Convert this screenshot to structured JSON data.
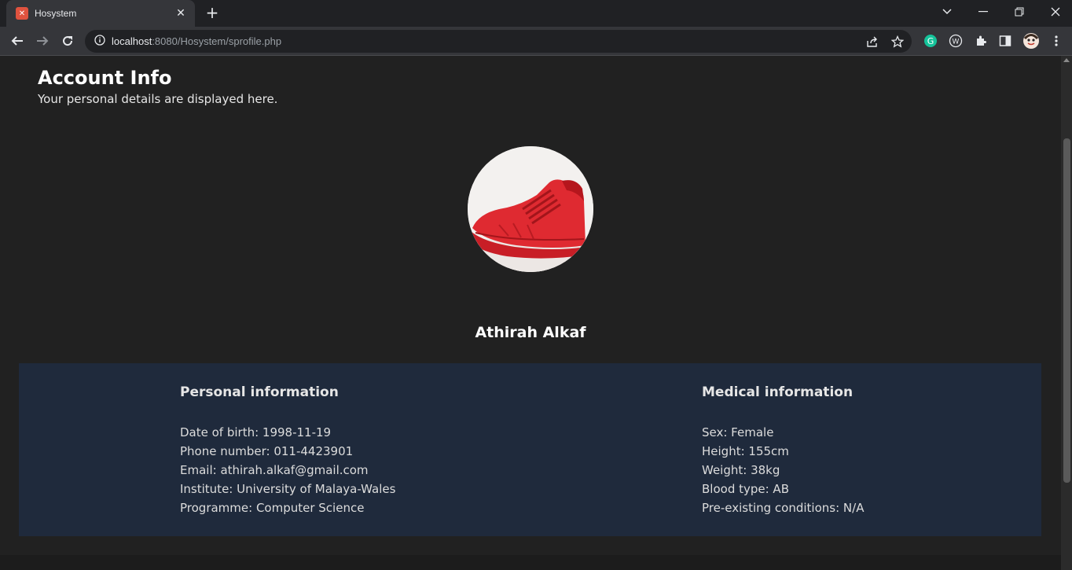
{
  "browser": {
    "tab_title": "Hosystem",
    "url_host": "localhost",
    "url_rest": ":8080/Hosystem/sprofile.php"
  },
  "page": {
    "title": "Account Info",
    "subtitle": "Your personal details are displayed here.",
    "profile_name": "Athirah Alkaf"
  },
  "personal": {
    "heading": "Personal information",
    "lines": [
      "Date of birth: 1998-11-19",
      "Phone number: 011-4423901",
      "Email: athirah.alkaf@gmail.com",
      "Institute: University of Malaya-Wales",
      "Programme: Computer Science"
    ]
  },
  "medical": {
    "heading": "Medical information",
    "lines": [
      "Sex: Female",
      "Height: 155cm",
      "Weight: 38kg",
      "Blood type: AB",
      "Pre-existing conditions: N/A"
    ]
  },
  "colors": {
    "page_bg": "#212121",
    "panel_bg": "#1f2a3c",
    "accent_shoe": "#d9222b"
  }
}
